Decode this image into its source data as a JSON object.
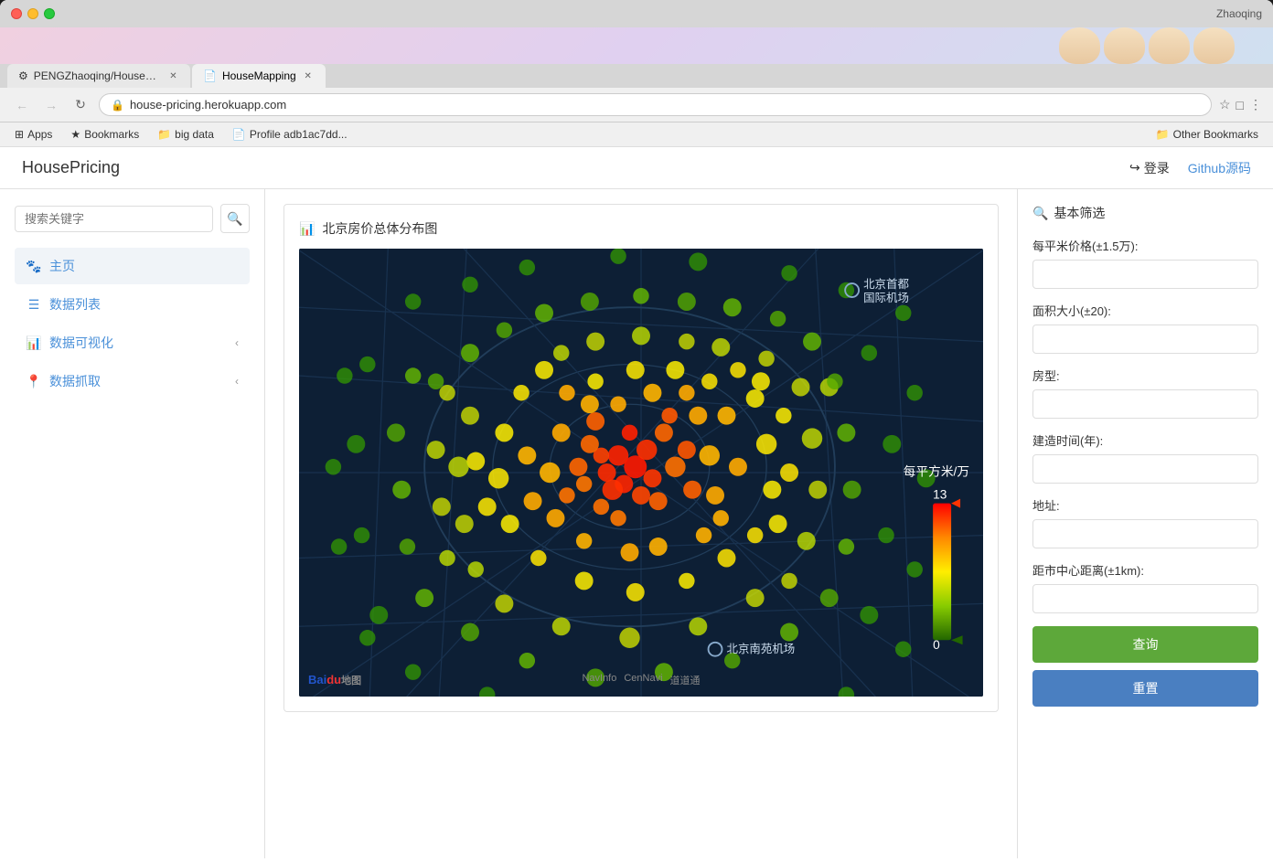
{
  "browser": {
    "title_bar": {
      "user": "Zhaoqing"
    },
    "tabs": [
      {
        "id": "tab1",
        "label": "PENGZhaoqing/HousePricing",
        "icon": "github",
        "active": false
      },
      {
        "id": "tab2",
        "label": "HouseMapping",
        "icon": "doc",
        "active": true
      }
    ],
    "address": {
      "url": "house-pricing.herokuapp.com"
    },
    "bookmarks": [
      {
        "label": "Apps",
        "icon": "grid"
      },
      {
        "label": "Bookmarks",
        "icon": "star"
      },
      {
        "label": "big data",
        "icon": "folder"
      },
      {
        "label": "Profile adb1ac7dd...",
        "icon": "doc"
      }
    ],
    "bookmarks_right": "Other Bookmarks"
  },
  "app": {
    "logo": "HousePricing",
    "login_label": "登录",
    "github_label": "Github源码"
  },
  "sidebar": {
    "search_placeholder": "搜索关键字",
    "search_icon": "🔍",
    "nav_items": [
      {
        "id": "home",
        "icon": "🐾",
        "label": "主页",
        "active": true,
        "has_chevron": false
      },
      {
        "id": "data-list",
        "icon": "☰",
        "label": "数据列表",
        "active": false,
        "has_chevron": false
      },
      {
        "id": "data-viz",
        "icon": "📊",
        "label": "数据可视化",
        "active": false,
        "has_chevron": true
      },
      {
        "id": "data-crawl",
        "icon": "📍",
        "label": "数据抓取",
        "active": false,
        "has_chevron": true
      }
    ]
  },
  "chart": {
    "title_icon": "📊",
    "title": "北京房价总体分布图",
    "map": {
      "annotation_top": "北京首都国际机场",
      "annotation_bottom": "北京南苑机场",
      "legend_title": "每平方米/万",
      "legend_max": "13",
      "legend_min": "0",
      "baidu_label": "Baidu地图",
      "footer_items": [
        "NavInfo",
        "CenNavi",
        "道道通"
      ]
    }
  },
  "filters": {
    "title_icon": "🔍",
    "title": "基本筛选",
    "fields": [
      {
        "id": "price",
        "label": "每平米价格(±1.5万):",
        "placeholder": ""
      },
      {
        "id": "area",
        "label": "面积大小(±20):",
        "placeholder": ""
      },
      {
        "id": "room_type",
        "label": "房型:",
        "placeholder": ""
      },
      {
        "id": "build_year",
        "label": "建造时间(年):",
        "placeholder": ""
      },
      {
        "id": "address",
        "label": "地址:",
        "placeholder": ""
      },
      {
        "id": "distance",
        "label": "距市中心距离(±1km):",
        "placeholder": ""
      }
    ],
    "query_btn": "查询",
    "reset_btn": "重置"
  }
}
